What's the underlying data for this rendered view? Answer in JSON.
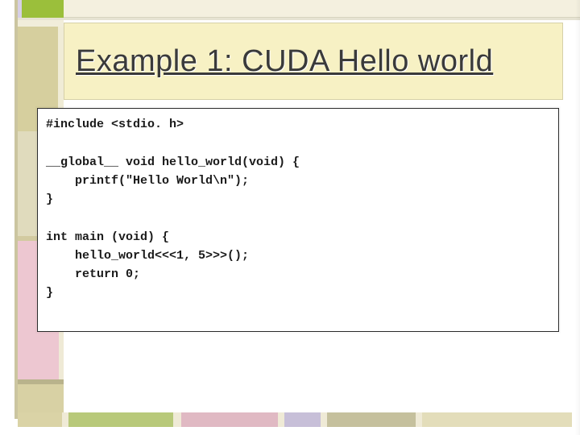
{
  "slide": {
    "title": "Example 1: CUDA Hello world"
  },
  "code": {
    "lines": [
      "#include <stdio. h>",
      "",
      "__global__ void hello_world(void) {",
      "    printf(\"Hello World\\n\");",
      "}",
      "",
      "int main (void) {",
      "    hello_world<<<1, 5>>>();",
      "    return 0;",
      "}"
    ]
  }
}
